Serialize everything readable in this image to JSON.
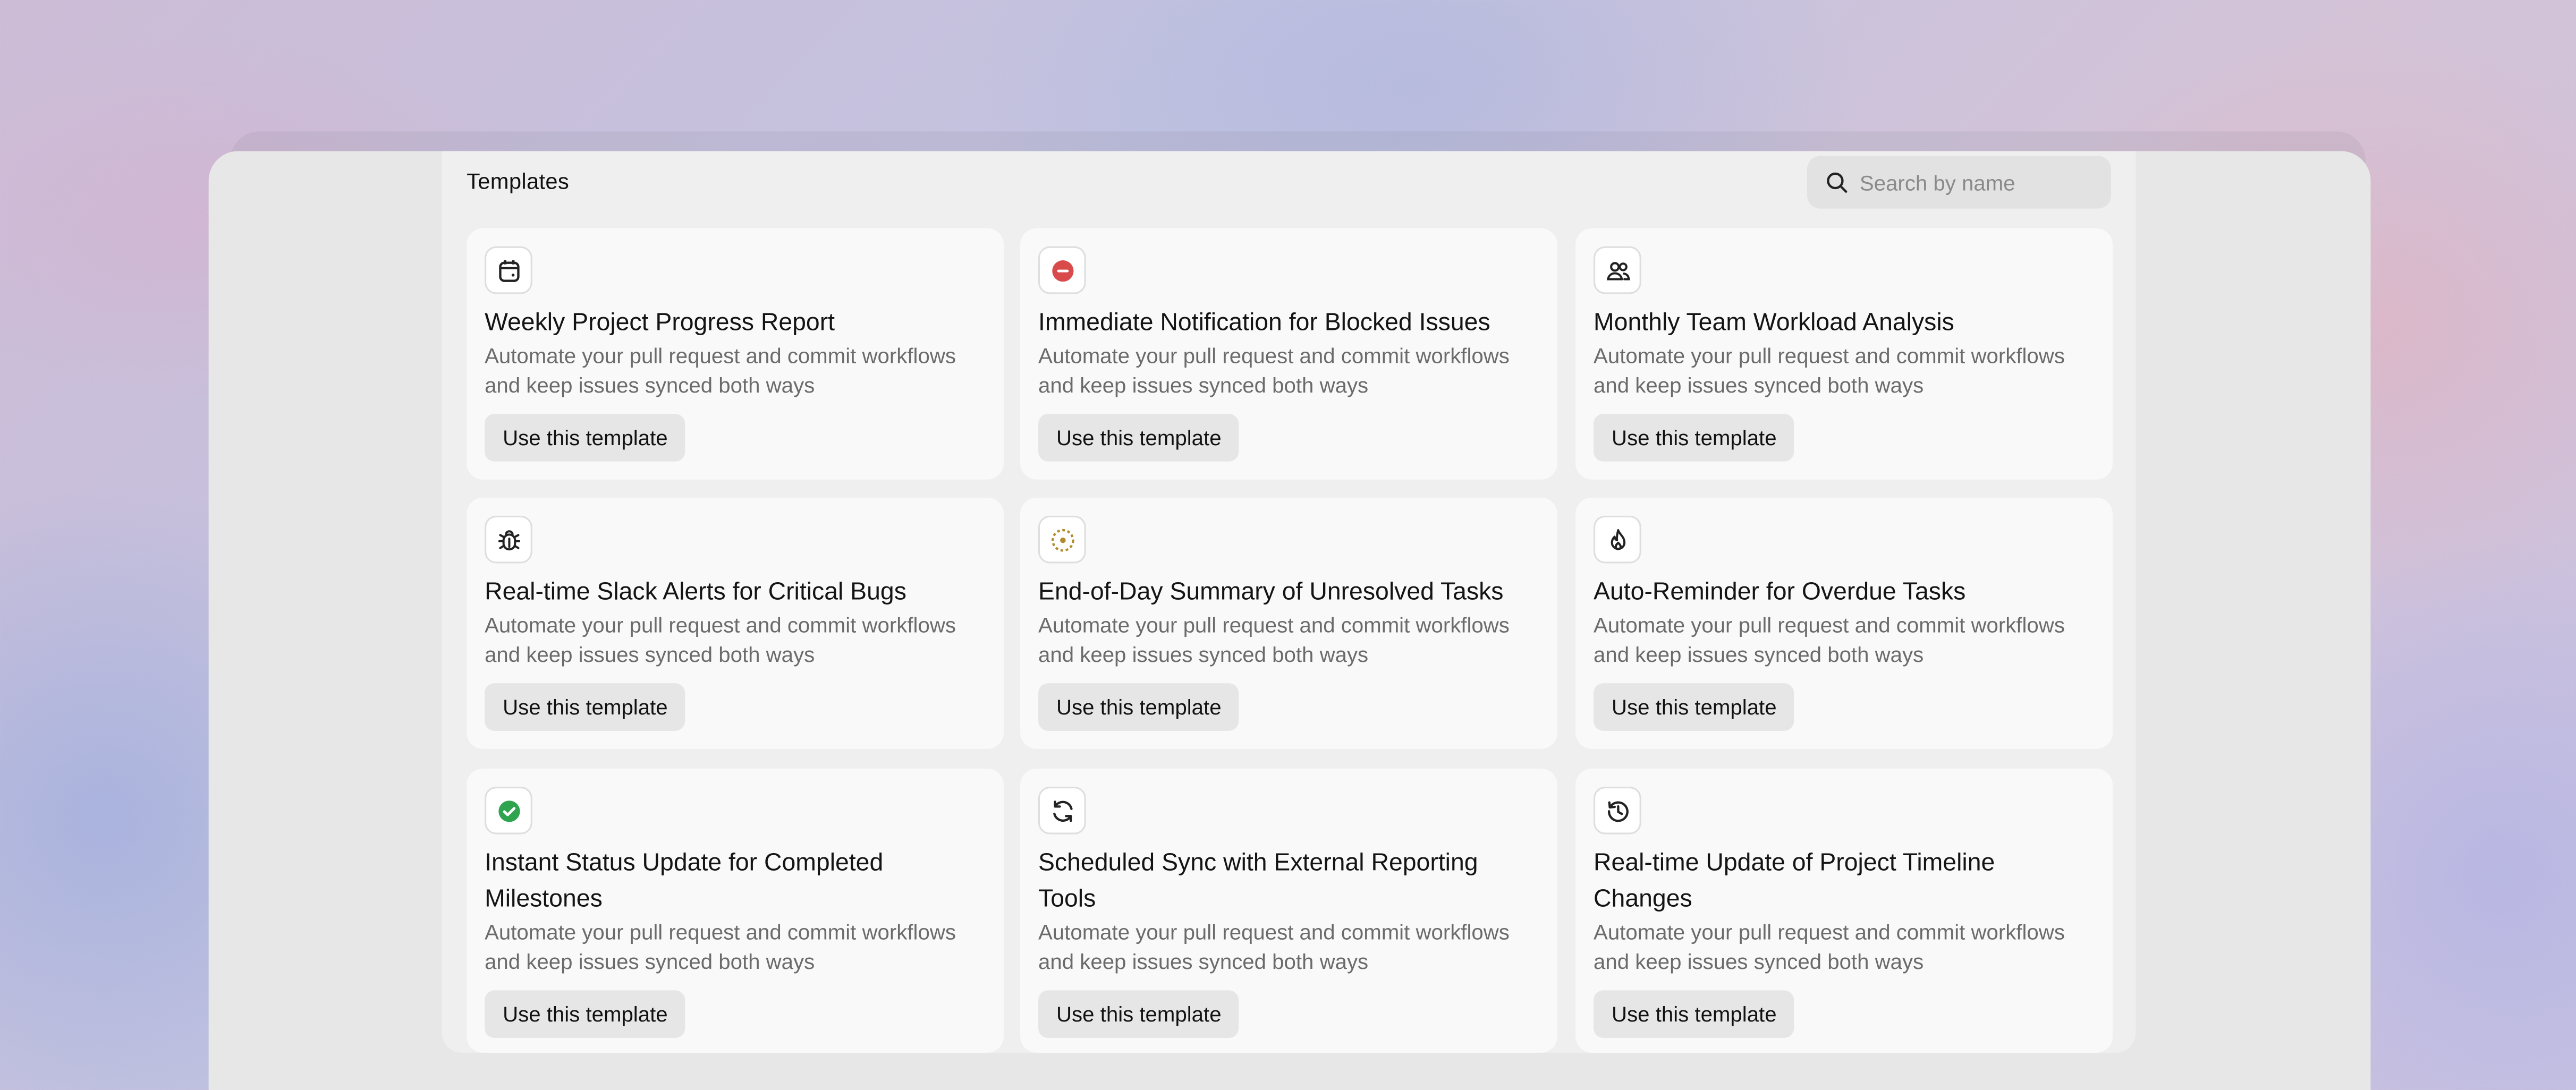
{
  "header": {
    "title": "Templates"
  },
  "search": {
    "placeholder": "Search by name",
    "value": ""
  },
  "templates": [
    {
      "icon": "calendar-icon",
      "title": "Weekly Project Progress Report",
      "description": "Automate your pull request and commit workflows and keep issues synced both ways",
      "button": "Use this template"
    },
    {
      "icon": "blocked-icon",
      "title": "Immediate Notification for Blocked Issues",
      "description": "Automate your pull request and commit workflows and keep issues synced both ways",
      "button": "Use this template"
    },
    {
      "icon": "team-icon",
      "title": "Monthly Team Workload Analysis",
      "description": "Automate your pull request and commit workflows and keep issues synced both ways",
      "button": "Use this template"
    },
    {
      "icon": "bug-icon",
      "title": "Real-time Slack Alerts for Critical Bugs",
      "description": "Automate your pull request and commit workflows and keep issues synced both ways",
      "button": "Use this template"
    },
    {
      "icon": "dotted-circle-icon",
      "title": "End-of-Day Summary of Unresolved Tasks",
      "description": "Automate your pull request and commit workflows and keep issues synced both ways",
      "button": "Use this template"
    },
    {
      "icon": "flame-icon",
      "title": "Auto-Reminder for Overdue Tasks",
      "description": "Automate your pull request and commit workflows and keep issues synced both ways",
      "button": "Use this template"
    },
    {
      "icon": "check-circle-icon",
      "title": "Instant Status Update for Completed Milestones",
      "description": "Automate your pull request and commit workflows and keep issues synced both ways",
      "button": "Use this template"
    },
    {
      "icon": "sync-icon",
      "title": "Scheduled Sync with External Reporting Tools",
      "description": "Automate your pull request and commit workflows and keep issues synced both ways",
      "button": "Use this template"
    },
    {
      "icon": "history-icon",
      "title": "Real-time Update of Project Timeline Changes",
      "description": "Automate your pull request and commit workflows and keep issues synced both ways",
      "button": "Use this template"
    }
  ],
  "colors": {
    "blocked": "#d94b4b",
    "done": "#2ea44f",
    "dotted": "#b08a2e",
    "panel": "#efefef",
    "card": "#f9f9f9"
  }
}
